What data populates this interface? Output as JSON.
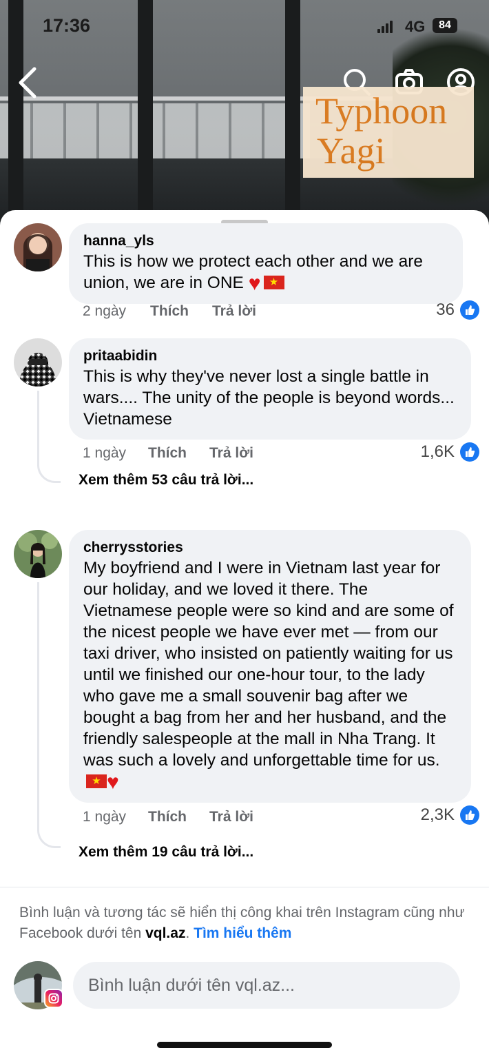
{
  "status_bar": {
    "time": "17:36",
    "network": "4G",
    "battery": "84"
  },
  "video": {
    "title_line1": "Typhoon",
    "title_line2": "Yagi"
  },
  "icons": {
    "back": "back-chevron-icon",
    "search": "search-icon",
    "camera": "camera-icon",
    "profile": "profile-icon",
    "like": "thumbs-up-icon",
    "instagram": "instagram-icon"
  },
  "comments": [
    {
      "author": "hanna_yls",
      "text": "This is how we protect each other and we are union, we are in ONE",
      "time": "2 ngày",
      "like_label": "Thích",
      "reply_label": "Trả lời",
      "likes": "36"
    },
    {
      "author": "pritaabidin",
      "text": "This is why they've never lost a single battle in wars.... The unity of the people is beyond words... Vietnamese",
      "time": "1 ngày",
      "like_label": "Thích",
      "reply_label": "Trả lời",
      "likes": "1,6K",
      "more_replies": "Xem thêm 53 câu trả lời..."
    },
    {
      "author": "cherrysstories",
      "text": "My boyfriend and I were in Vietnam last year for our holiday, and we loved it there. The Vietnamese people were so kind and are some of the nicest people we have ever met — from our taxi driver, who insisted on patiently waiting for us until we finished our one-hour tour, to the lady who gave me a small souvenir bag after we bought a bag from her and her husband, and the friendly salespeople at the mall in Nha Trang. It was such a lovely and unforgettable time for us.",
      "time": "1 ngày",
      "like_label": "Thích",
      "reply_label": "Trả lời",
      "likes": "2,3K",
      "more_replies": "Xem thêm 19 câu trả lời..."
    }
  ],
  "notice": {
    "text_before": "Bình luận và tương tác sẽ hiển thị công khai trên Instagram cũng như Facebook dưới tên ",
    "username": "vql.az",
    "text_after": ". ",
    "link": "Tìm hiểu thêm"
  },
  "composer": {
    "placeholder": "Bình luận dưới tên vql.az..."
  },
  "colors": {
    "accent": "#1877f2",
    "bubble": "#f0f2f5",
    "muted": "#65676b",
    "title": "#e07d1f"
  }
}
